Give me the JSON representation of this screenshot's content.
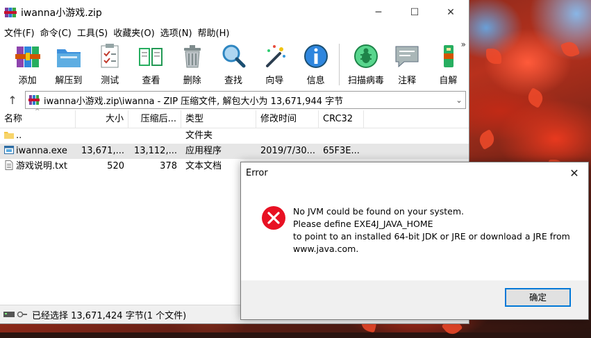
{
  "window": {
    "title": "iwanna小游戏.zip",
    "controls": {
      "minimize": "─",
      "maximize": "☐",
      "close": "✕"
    }
  },
  "menu": [
    "文件(F)",
    "命令(C)",
    "工具(S)",
    "收藏夹(O)",
    "选项(N)",
    "帮助(H)"
  ],
  "toolbar": {
    "buttons": [
      {
        "label": "添加",
        "icon": "books-add-icon"
      },
      {
        "label": "解压到",
        "icon": "folder-extract-icon"
      },
      {
        "label": "测试",
        "icon": "clipboard-test-icon"
      },
      {
        "label": "查看",
        "icon": "book-view-icon"
      },
      {
        "label": "删除",
        "icon": "trash-bin-icon"
      },
      {
        "label": "查找",
        "icon": "magnifier-icon"
      },
      {
        "label": "向导",
        "icon": "magic-wand-icon"
      },
      {
        "label": "信息",
        "icon": "info-icon"
      },
      {
        "label": "扫描病毒",
        "icon": "bug-scan-icon"
      },
      {
        "label": "注释",
        "icon": "comment-icon"
      },
      {
        "label": "自解",
        "icon": "sfx-icon"
      }
    ],
    "overflow": "»"
  },
  "address": {
    "up": "↑",
    "path": "iwanna小游戏.zip\\iwanna - ZIP 压缩文件, 解包大小为 13,671,944 字节",
    "dropdown": "⌄"
  },
  "columns": [
    "名称",
    "大小",
    "压缩后...",
    "类型",
    "修改时间",
    "CRC32"
  ],
  "sort_indicator": "^",
  "files": [
    {
      "name": "..",
      "size": "",
      "packed": "",
      "type": "文件夹",
      "modified": "",
      "crc": "",
      "icon": "folder-icon"
    },
    {
      "name": "iwanna.exe",
      "size": "13,671,...",
      "packed": "13,112,...",
      "type": "应用程序",
      "modified": "2019/7/30...",
      "crc": "65F3E...",
      "icon": "exe-icon",
      "selected": true
    },
    {
      "name": "游戏说明.txt",
      "size": "520",
      "packed": "378",
      "type": "文本文档",
      "modified": "",
      "crc": "",
      "icon": "text-file-icon"
    }
  ],
  "status": {
    "text": "已经选择 13,671,424 字节(1 个文件)"
  },
  "dialog": {
    "title": "Error",
    "close": "✕",
    "lines": [
      "No JVM could be found on your system.",
      "Please define EXE4J_JAVA_HOME",
      "to point to an installed 64-bit JDK or JRE or download a JRE from",
      "www.java.com."
    ],
    "ok": "确定"
  },
  "colors": {
    "dialog_border": "#0078d7",
    "error_red": "#e81123",
    "selected_row": "#e6e6e6"
  }
}
